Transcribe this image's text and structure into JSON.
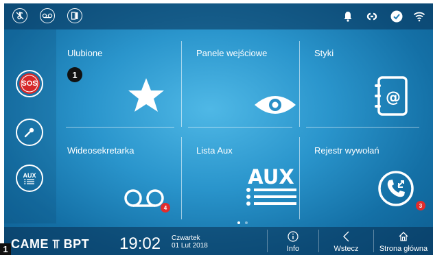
{
  "colors": {
    "badge": "#e12d2d",
    "sos": "#d62828",
    "accent_bg": "#2a95cc"
  },
  "statusbar": {
    "left_icons": [
      "music-note-off-icon",
      "voicemail-icon",
      "door-panel-icon"
    ],
    "right_icons": [
      "bell-icon",
      "link-icon",
      "check-circle-icon",
      "wifi-icon"
    ]
  },
  "sidebar": {
    "sos_label": "SOS",
    "aux_label": "AUX"
  },
  "tiles": [
    {
      "label": "Ulubione",
      "marker": "1"
    },
    {
      "label": "Panele wejściowe"
    },
    {
      "label": "Styki"
    },
    {
      "label": "Wideosekretarka",
      "badge": "4"
    },
    {
      "label": "Lista Aux",
      "icon_text": "AUX"
    },
    {
      "label": "Rejestr wywołań",
      "badge": "3"
    }
  ],
  "bottombar": {
    "brand": "CAME ⫪ BPT",
    "time": "19:02",
    "weekday": "Czwartek",
    "date": "01 Lut 2018",
    "nav": [
      {
        "label": "Info",
        "icon": "info-icon"
      },
      {
        "label": "Wstecz",
        "icon": "back-chevron-icon"
      },
      {
        "label": "Strona główna",
        "icon": "home-icon"
      }
    ]
  },
  "page_indicator": {
    "pages": 2,
    "current": 1
  },
  "corner_tag": "1"
}
